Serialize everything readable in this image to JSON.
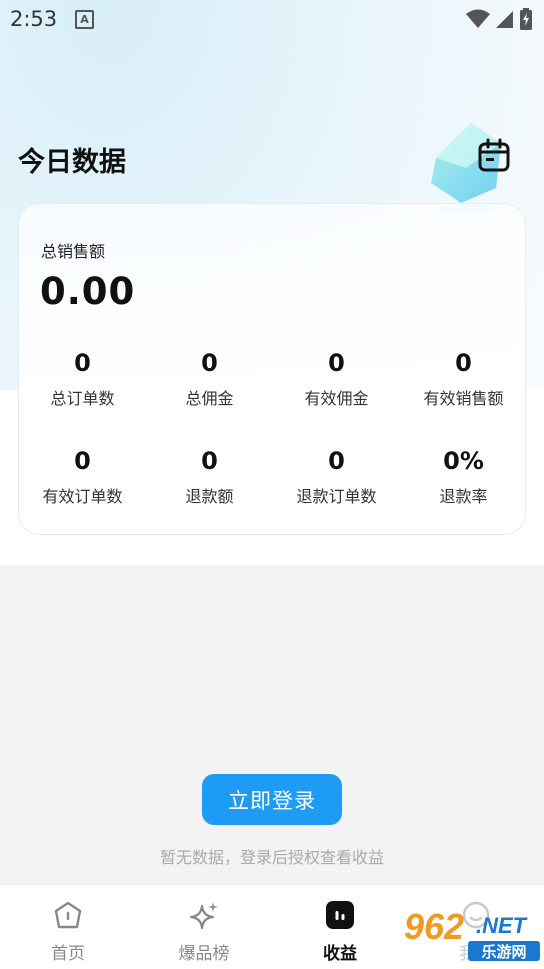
{
  "status_bar": {
    "time": "2:53",
    "notification_badge": "A"
  },
  "header": {
    "title": "今日数据"
  },
  "summary": {
    "total_sales_label": "总销售额",
    "total_sales_value": "0.00",
    "stats": [
      {
        "value": "0",
        "label": "总订单数"
      },
      {
        "value": "0",
        "label": "总佣金"
      },
      {
        "value": "0",
        "label": "有效佣金"
      },
      {
        "value": "0",
        "label": "有效销售额"
      },
      {
        "value": "0",
        "label": "有效订单数"
      },
      {
        "value": "0",
        "label": "退款额"
      },
      {
        "value": "0",
        "label": "退款订单数"
      },
      {
        "value": "0%",
        "label": "退款率"
      }
    ]
  },
  "login": {
    "button_label": "立即登录",
    "hint": "暂无数据，登录后授权查看收益"
  },
  "tabbar": {
    "items": [
      {
        "label": "首页",
        "icon": "home-icon"
      },
      {
        "label": "爆品榜",
        "icon": "sparkle-icon"
      },
      {
        "label": "收益",
        "icon": "earnings-icon",
        "active": true
      },
      {
        "label": "我的",
        "icon": "profile-icon"
      }
    ]
  },
  "watermark": {
    "brand": "962.NET",
    "sub": "乐游网"
  },
  "colors": {
    "accent": "#1e9cf5",
    "tab_active": "#111111",
    "tab_inactive": "#888888"
  }
}
